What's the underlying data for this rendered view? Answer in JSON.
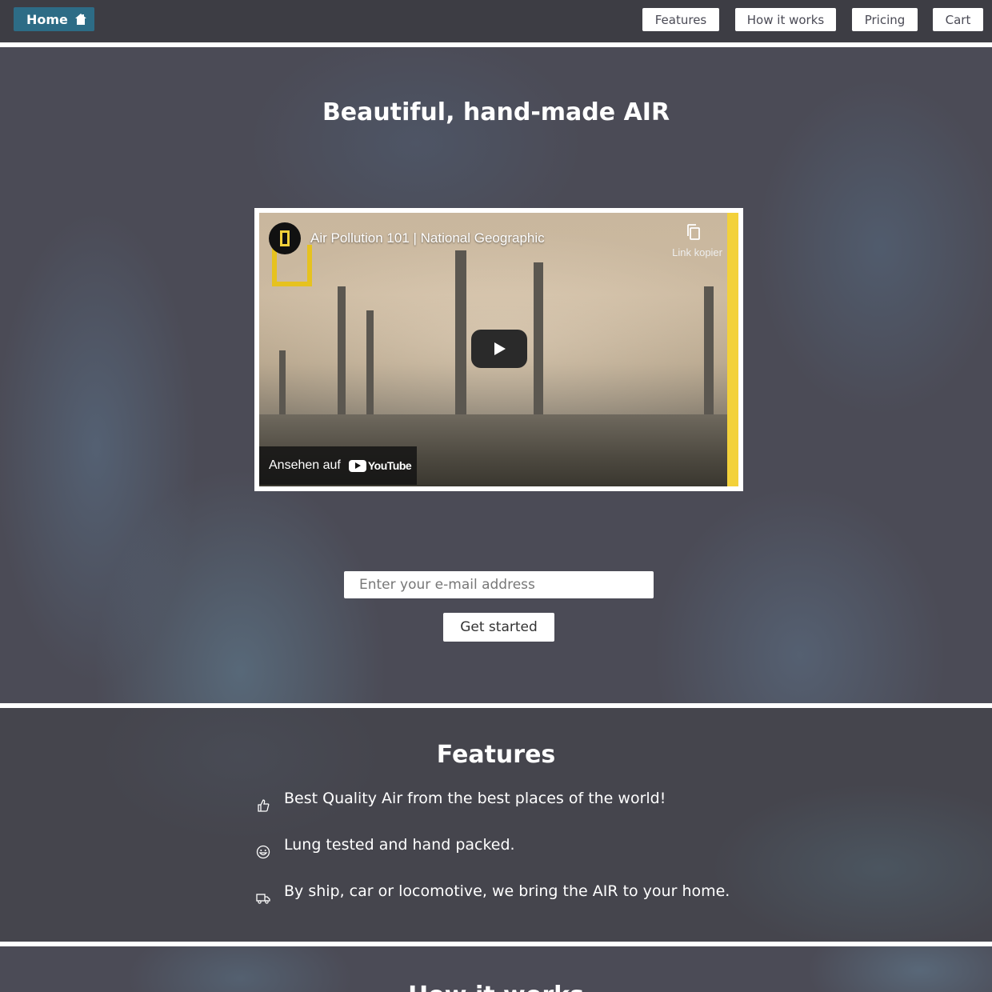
{
  "nav": {
    "home_label": "Home",
    "links": [
      "Features",
      "How it works",
      "Pricing",
      "Cart"
    ]
  },
  "hero": {
    "title": "Beautiful, hand-made AIR",
    "video": {
      "title": "Air Pollution 101 | National Geographic",
      "copy_link_label": "Link kopier",
      "watch_on_label": "Ansehen auf",
      "platform": "YouTube"
    },
    "email_placeholder": "Enter your e-mail address",
    "cta_label": "Get started"
  },
  "features": {
    "title": "Features",
    "items": [
      {
        "icon": "thumbs-up-icon",
        "text": "Best Quality Air from the best places of the world!"
      },
      {
        "icon": "smile-icon",
        "text": "Lung tested and hand packed."
      },
      {
        "icon": "truck-icon",
        "text": "By ship, car or locomotive, we bring the AIR to your home."
      }
    ]
  },
  "next_section": {
    "title": "How it works"
  },
  "colors": {
    "home_button": "#2d6c86",
    "background": "#4a4a55",
    "accent_yellow": "#f3d13a"
  }
}
